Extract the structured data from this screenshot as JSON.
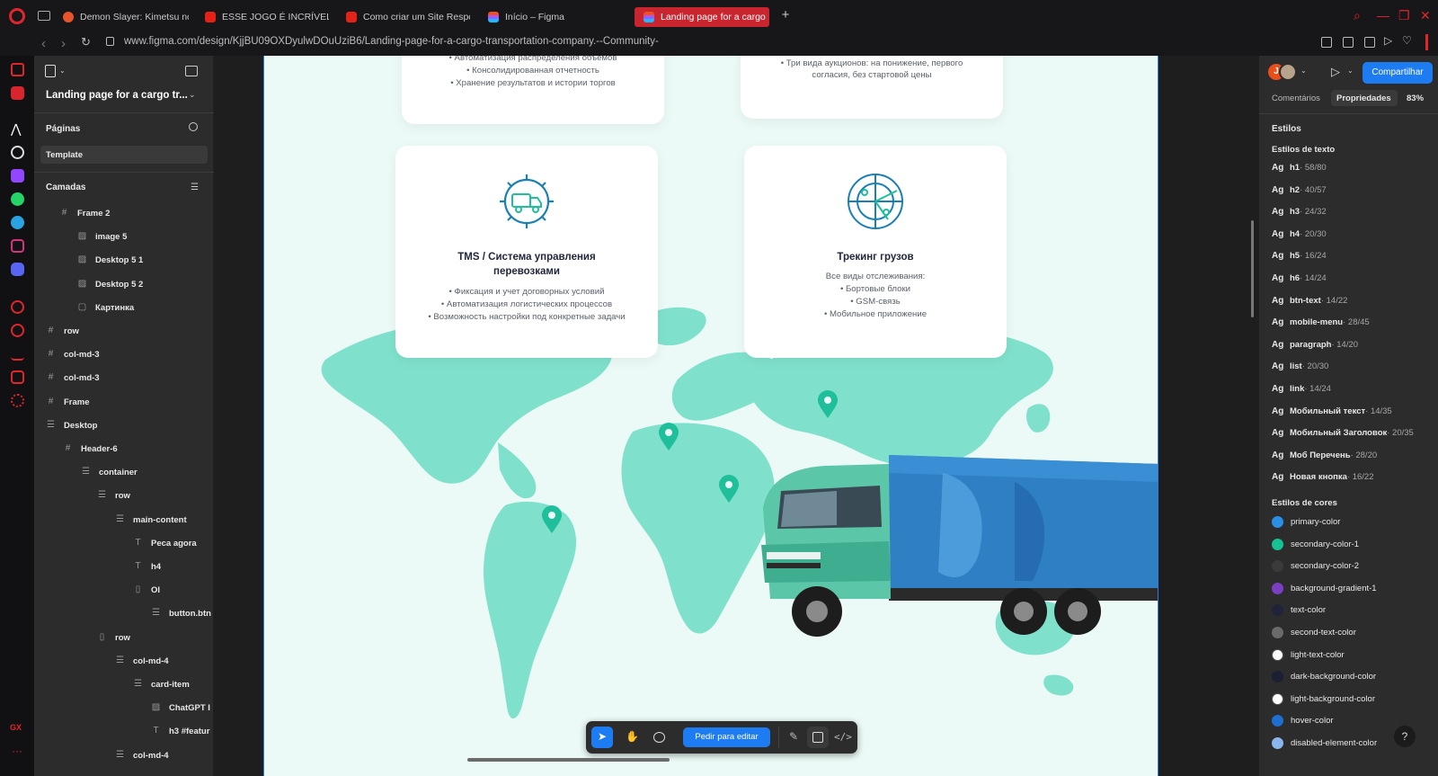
{
  "browser": {
    "tabs": [
      {
        "label": "Demon Slayer: Kimetsu no",
        "fav_color": "#e8542c"
      },
      {
        "label": "ESSE JOGO É INCRÍVEL!",
        "fav_color": "#e62117"
      },
      {
        "label": "Como criar um Site Respo",
        "fav_color": "#e62117"
      },
      {
        "label": "Início – Figma",
        "fav_color": "#a259ff"
      },
      {
        "label": "Landing page for a cargo",
        "fav_color": "#a259ff"
      }
    ],
    "url": "www.figma.com/design/KjjBU09OXDyulwDOuUziB6/Landing-page-for-a-cargo-transportation-company.--Community-"
  },
  "left_panel": {
    "file_title": "Landing page for a cargo tr...",
    "pages_label": "Páginas",
    "page_current": "Template",
    "layers_label": "Camadas",
    "layers": [
      {
        "label": "Frame 2",
        "icon": "#",
        "bold": true
      },
      {
        "label": "image 5",
        "icon": "▨",
        "bold": true
      },
      {
        "label": "Desktop 5 1",
        "icon": "▨",
        "bold": true
      },
      {
        "label": "Desktop 5 2",
        "icon": "▨",
        "bold": true
      },
      {
        "label": "Картинка",
        "icon": "▢",
        "bold": true
      },
      {
        "label": "row",
        "icon": "#",
        "bold": true
      },
      {
        "label": "col-md-3",
        "icon": "#",
        "bold": true
      },
      {
        "label": "col-md-3",
        "icon": "#",
        "bold": true
      },
      {
        "label": "Frame",
        "icon": "#",
        "bold": true
      },
      {
        "label": "Desktop",
        "icon": "☰",
        "bold": true
      },
      {
        "label": "Header-6",
        "icon": "#",
        "bold": true
      },
      {
        "label": "container",
        "icon": "☰",
        "bold": true
      },
      {
        "label": "row",
        "icon": "☰",
        "bold": true
      },
      {
        "label": "main-content",
        "icon": "☰",
        "bold": true
      },
      {
        "label": "Peca agora",
        "icon": "T",
        "bold": true
      },
      {
        "label": "h4",
        "icon": "T",
        "bold": true
      },
      {
        "label": "OI",
        "icon": "▯",
        "bold": true
      },
      {
        "label": "button.btn",
        "icon": "☰",
        "bold": true
      },
      {
        "label": "row",
        "icon": "▯",
        "bold": true
      },
      {
        "label": "col-md-4",
        "icon": "☰",
        "bold": true
      },
      {
        "label": "card-item",
        "icon": "☰",
        "bold": true
      },
      {
        "label": "ChatGPT I",
        "icon": "▨",
        "bold": true
      },
      {
        "label": "h3 #featur",
        "icon": "T",
        "bold": true
      },
      {
        "label": "col-md-4",
        "icon": "☰",
        "bold": true
      }
    ]
  },
  "canvas": {
    "top_card_left_lines": [
      "• Автоматизация распределения объемов",
      "• Консолидированная отчетность",
      "• Хранение результатов и истории торгов"
    ],
    "top_card_right_lines": [
      "• Три вида аукционов: на понижение, первого",
      "согласия, без стартовой цены"
    ],
    "card_tms": {
      "title_line1": "TMS / Система управления",
      "title_line2": "перевозками",
      "lines": [
        "• Фиксация и учет договорных условий",
        "• Автоматизация логистических процессов",
        "• Возможность настройки под конкретные задачи"
      ]
    },
    "card_tracking": {
      "title": "Трекинг грузов",
      "lines": [
        "Все виды отслеживания:",
        "• Бортовые блоки",
        "• GSM-связь",
        "• Мобильное приложение"
      ]
    },
    "colors": {
      "map": "#7fe1cc",
      "pin": "#1fbf9b",
      "accent_blue": "#2f7fe0"
    },
    "toolbar": {
      "edit_label": "Pedir para editar"
    }
  },
  "right_panel": {
    "avatar_letter": "J",
    "share_label": "Compartilhar",
    "tab_comments": "Comentários",
    "tab_properties": "Propriedades",
    "zoom": "83%",
    "styles_label": "Estilos",
    "text_styles_label": "Estilos de texto",
    "text_styles": [
      {
        "ag": "Ag",
        "name": "h1",
        "meta": " · 58/80"
      },
      {
        "ag": "Ag",
        "name": "h2",
        "meta": " · 40/57"
      },
      {
        "ag": "Ag",
        "name": "h3",
        "meta": " · 24/32"
      },
      {
        "ag": "Ag",
        "name": "h4",
        "meta": " · 20/30"
      },
      {
        "ag": "Ag",
        "name": "h5",
        "meta": " · 16/24"
      },
      {
        "ag": "Ag",
        "name": "h6",
        "meta": " · 14/24"
      },
      {
        "ag": "Ag",
        "name": "btn-text",
        "meta": " · 14/22"
      },
      {
        "ag": "Ag",
        "name": "mobile-menu",
        "meta": " · 28/45"
      },
      {
        "ag": "Ag",
        "name": "paragraph",
        "meta": " · 14/20"
      },
      {
        "ag": "Ag",
        "name": "list",
        "meta": " · 20/30"
      },
      {
        "ag": "Ag",
        "name": "link",
        "meta": " · 14/24"
      },
      {
        "ag": "Ag",
        "name": "Мобильный текст",
        "meta": " · 14/35"
      },
      {
        "ag": "Ag",
        "name": "Мобильный Заголовок",
        "meta": " · 20/35"
      },
      {
        "ag": "Ag",
        "name": "Моб Перечень",
        "meta": " · 28/20"
      },
      {
        "ag": "Ag",
        "name": "Новая кнопка",
        "meta": " · 16/22"
      }
    ],
    "color_styles_label": "Estilos de cores",
    "color_styles": [
      {
        "name": "primary-color",
        "color": "#2a8fe6"
      },
      {
        "name": "secondary-color-1",
        "color": "#16c293"
      },
      {
        "name": "secondary-color-2",
        "color": "#3a3a3a"
      },
      {
        "name": "background-gradient-1",
        "color": "#7a3fc2"
      },
      {
        "name": "text-color",
        "color": "#20243a"
      },
      {
        "name": "second-text-color",
        "color": "#6a6a6a"
      },
      {
        "name": "light-text-color",
        "color": "#ffffff"
      },
      {
        "name": "dark-background-color",
        "color": "#1a1f33"
      },
      {
        "name": "light-background-color",
        "color": "#ffffff"
      },
      {
        "name": "hover-color",
        "color": "#1e6fd0"
      },
      {
        "name": "disabled-element-color",
        "color": "#8ab6ec"
      }
    ],
    "help": "?"
  }
}
